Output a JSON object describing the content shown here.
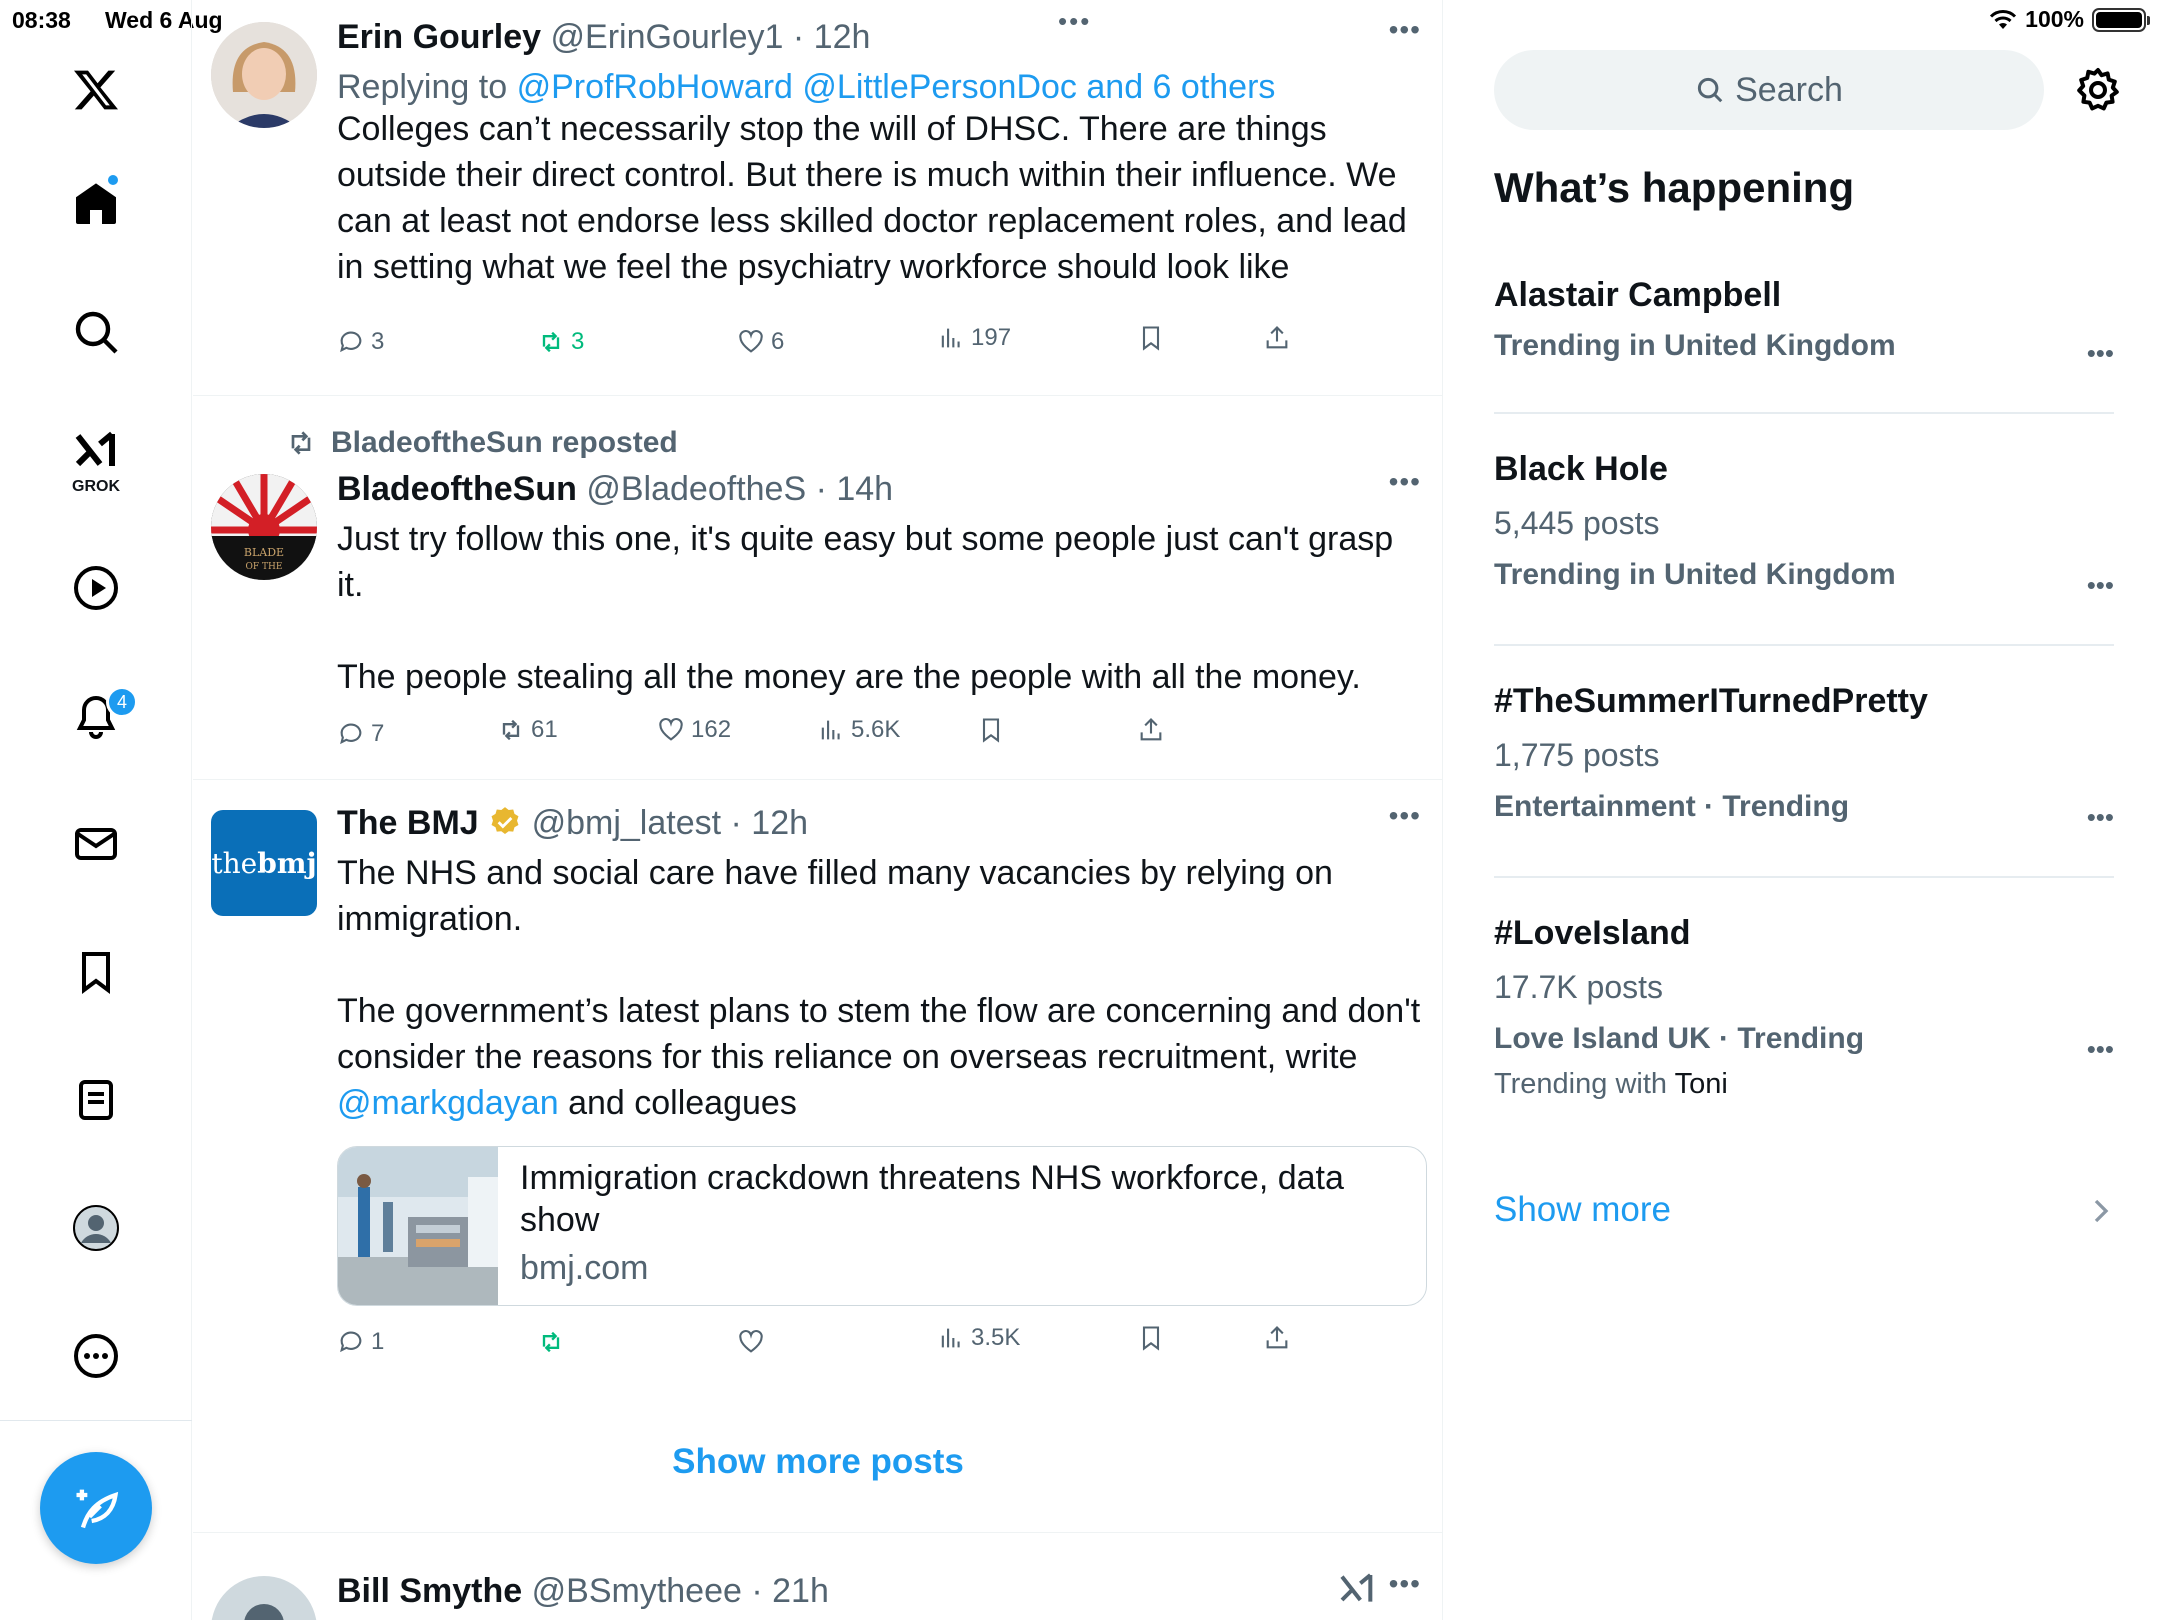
{
  "status_bar": {
    "time": "08:38",
    "date": "Wed 6 Aug",
    "battery": "100%",
    "battery_level": 1.0
  },
  "nav": {
    "items": [
      "x-logo",
      "home",
      "search",
      "grok",
      "video",
      "notifications",
      "messages",
      "bookmarks",
      "lists",
      "profile",
      "more"
    ],
    "grok_label": "GROK",
    "notification_count": "4"
  },
  "timeline": {
    "posts": [
      {
        "name": "Erin Gourley",
        "handle": "@ErinGourley1",
        "time": "· 12h",
        "replying_prefix": "Replying to",
        "replying_to": "@ProfRobHoward @LittlePersonDoc and 6 others",
        "text": "Colleges can’t necessarily stop the will of DHSC. There are things outside their direct control. But there is much within their influence. We can at least not endorse less skilled doctor replacement roles, and lead in setting what we feel the psychiatry workforce should look like",
        "replies": "3",
        "reposts": "3",
        "likes": "6",
        "views": "197"
      },
      {
        "reposted_by": "BladeoftheSun reposted",
        "name": "BladeoftheSun",
        "handle": "@BladeoftheS",
        "time": "· 14h",
        "avatar_text_1": "BLADE",
        "avatar_text_2": "OF THE",
        "text_p1": "Just try follow this one, it's quite easy but some people just can't grasp it.",
        "text_p2": "The people stealing all the money are the people with all the money.",
        "replies": "7",
        "reposts": "61",
        "likes": "162",
        "views": "5.6K"
      },
      {
        "name": "The BMJ",
        "handle": "@bmj_latest",
        "time": "· 12h",
        "avatar_text_1": "the",
        "avatar_text_2": "bmj",
        "text_p1": "The NHS and social care have filled many vacancies by relying on immigration.",
        "text_p2_before": "The government’s latest plans to stem the flow are concerning and don't consider the reasons for this reliance on overseas recruitment, write",
        "text_p2_link": "@markgdayan",
        "text_p2_after": "and colleagues",
        "card_title": "Immigration crackdown threatens NHS workforce, data show",
        "card_domain": "bmj.com",
        "replies": "1",
        "views": "3.5K"
      },
      {
        "name": "Bill Smythe",
        "handle": "@BSmytheee",
        "time": "· 21h"
      }
    ],
    "show_more_posts": "Show more posts"
  },
  "sidebar": {
    "search_placeholder": "Search",
    "section_title": "What’s happening",
    "trends": [
      {
        "name": "Alastair Campbell",
        "context": "Trending in United Kingdom"
      },
      {
        "name": "Black Hole",
        "posts": "5,445 posts",
        "context": "Trending in United Kingdom"
      },
      {
        "name": "#TheSummerITurnedPretty",
        "posts": "1,775 posts",
        "context": "Entertainment · Trending"
      },
      {
        "name": "#LoveIsland",
        "posts": "17.7K posts",
        "context": "Love Island UK · Trending",
        "with_prefix": "Trending with",
        "with_name": "Toni"
      }
    ],
    "show_more": "Show more"
  },
  "colors": {
    "accent": "#1d9bf0",
    "secondary_text": "#536471",
    "repost_green": "#00ba7c",
    "gold_badge": "#e8b730"
  }
}
